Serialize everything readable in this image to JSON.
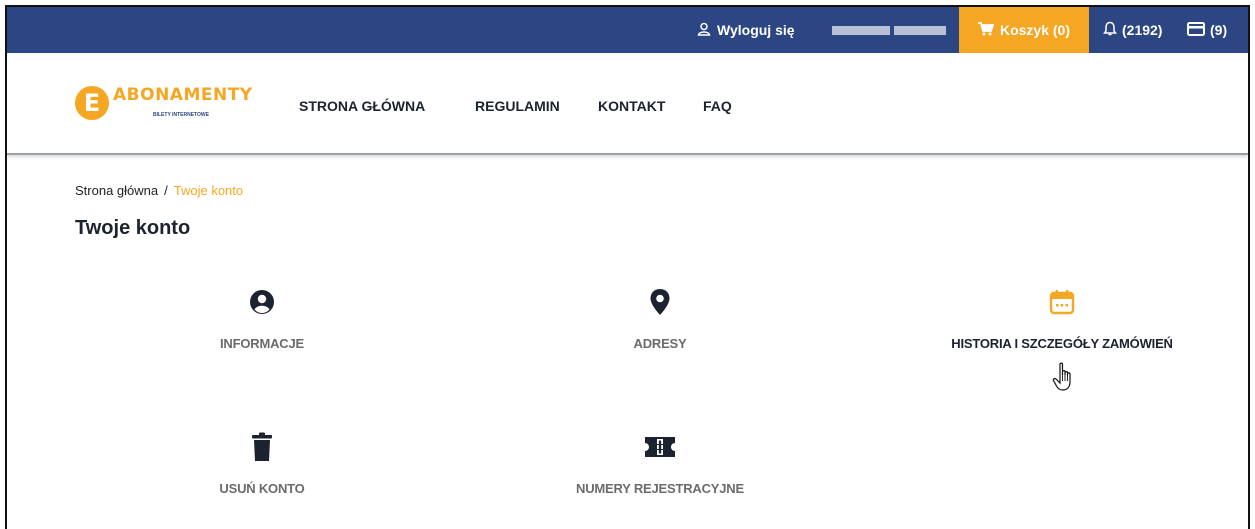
{
  "topbar": {
    "logout_label": "Wyloguj się",
    "cart_label": "Koszyk (0)",
    "notifications_label": "(2192)",
    "subscriptions_label": "(9)"
  },
  "header": {
    "logo_letter": "E",
    "logo_text": "ABONAMENTY",
    "logo_subtext": "BILETY INTERNETOWE",
    "nav": [
      "STRONA GŁÓWNA",
      "REGULAMIN",
      "KONTAKT",
      "FAQ"
    ]
  },
  "breadcrumb": {
    "home": "Strona główna",
    "separator": "/",
    "current": "Twoje konto"
  },
  "page_title": "Twoje konto",
  "tiles": [
    {
      "label": "INFORMACJE",
      "icon": "user-circle-icon"
    },
    {
      "label": "ADRESY",
      "icon": "map-marker-icon"
    },
    {
      "label": "HISTORIA I SZCZEGÓŁY ZAMÓWIEŃ",
      "icon": "calendar-icon"
    },
    {
      "label": "USUŃ KONTO",
      "icon": "trash-icon"
    },
    {
      "label": "NUMERY REJESTRACYJNE",
      "icon": "ticket-icon"
    }
  ],
  "colors": {
    "topbar": "#2b4683",
    "accent": "#f5a623",
    "text": "#1b2330",
    "muted_label": "#6b6b6b"
  }
}
